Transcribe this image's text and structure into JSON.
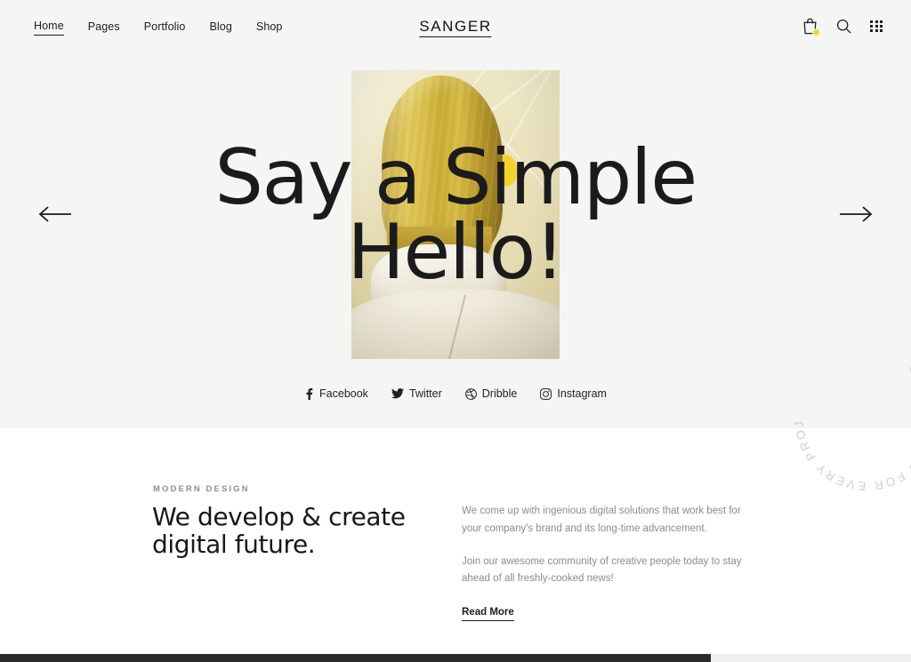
{
  "header": {
    "logo": "SANGER",
    "nav": [
      {
        "label": "Home",
        "active": true
      },
      {
        "label": "Pages",
        "active": false
      },
      {
        "label": "Portfolio",
        "active": false
      },
      {
        "label": "Blog",
        "active": false
      },
      {
        "label": "Shop",
        "active": false
      }
    ],
    "icons": [
      {
        "name": "shopping-bag-icon",
        "badge": true
      },
      {
        "name": "search-icon",
        "badge": false
      },
      {
        "name": "grid-menu-icon",
        "badge": false
      }
    ]
  },
  "hero": {
    "title_line1": "Say a Simple",
    "title_line2": "Hello!",
    "prev_arrow": "previous-slide",
    "next_arrow": "next-slide",
    "image_alt": "Back view of a person with blonde bob hair wearing a white collared jacket"
  },
  "socials": [
    {
      "label": "Facebook",
      "icon": "facebook-icon"
    },
    {
      "label": "Twitter",
      "icon": "twitter-icon"
    },
    {
      "label": "Dribble",
      "icon": "dribbble-icon"
    },
    {
      "label": "Instagram",
      "icon": "instagram-icon"
    }
  ],
  "badge": {
    "text": "UNIQUE IDEAS FOR EVERY PROJECT."
  },
  "about": {
    "eyebrow": "MODERN DESIGN",
    "heading": "We develop & create digital future.",
    "paragraph1": "We come up with ingenious digital solutions that work best for your company's brand and its long-time advancement.",
    "paragraph2": "Join our awesome community of creative people today to stay ahead of all freshly-cooked news!",
    "cta": "Read More"
  },
  "colors": {
    "hero_background": "#f5f5f4",
    "page_background": "#ffffff",
    "text_dark": "#1b1b1b",
    "text_muted": "#8b8b8b",
    "accent_yellow": "#f5d428",
    "badge_text": "#cfcfcf"
  }
}
